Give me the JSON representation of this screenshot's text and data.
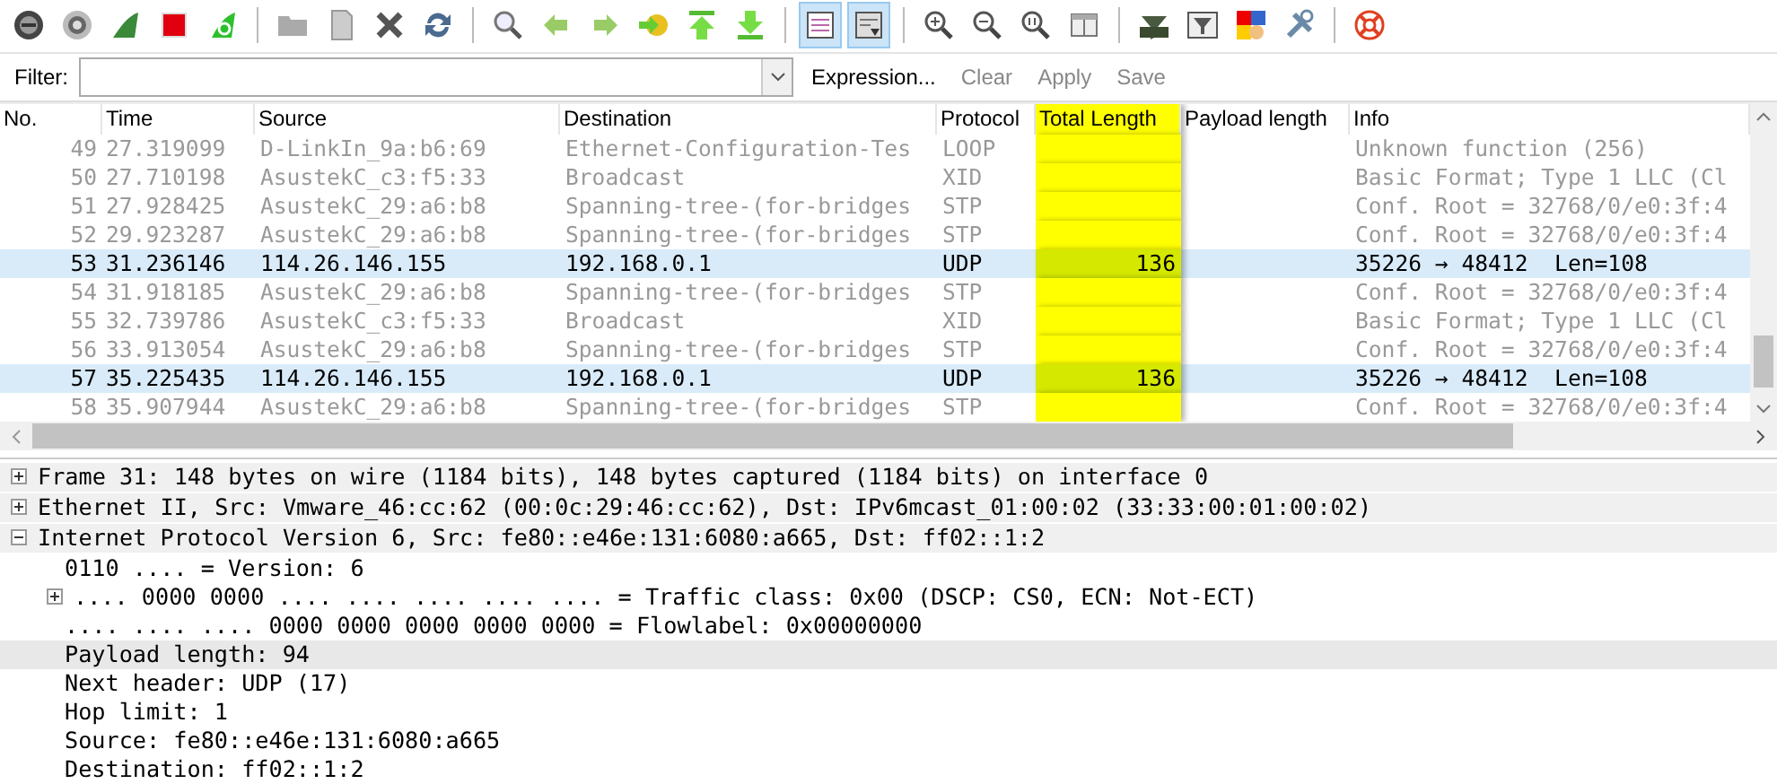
{
  "toolbar": {
    "groups": [
      [
        {
          "pressed": false
        },
        {
          "pressed": false
        },
        {
          "pressed": false
        },
        {
          "pressed": false
        },
        {
          "pressed": false
        }
      ],
      [
        {
          "pressed": false
        },
        {
          "pressed": false
        },
        {
          "pressed": false
        },
        {
          "pressed": false
        }
      ],
      [
        {
          "pressed": false
        },
        {
          "pressed": false
        },
        {
          "pressed": false
        },
        {
          "pressed": false
        },
        {
          "pressed": false
        },
        {
          "pressed": false
        }
      ],
      [
        {
          "pressed": true
        },
        {
          "pressed": true
        }
      ],
      [
        {
          "pressed": false
        },
        {
          "pressed": false
        },
        {
          "pressed": false
        },
        {
          "pressed": false
        }
      ],
      [
        {
          "pressed": false
        },
        {
          "pressed": false
        },
        {
          "pressed": false
        },
        {
          "pressed": false
        }
      ],
      [
        {
          "pressed": false
        }
      ]
    ]
  },
  "filter_bar": {
    "label": "Filter:",
    "expression": "Expression...",
    "actions": [
      {
        "label": "Clear",
        "disabled": true
      },
      {
        "label": "Apply",
        "disabled": true
      },
      {
        "label": "Save",
        "disabled": true
      }
    ]
  },
  "packet_list": {
    "columns": [
      {
        "label": "No.",
        "selected": false
      },
      {
        "label": "Time",
        "selected": false
      },
      {
        "label": "Source",
        "selected": false
      },
      {
        "label": "Destination",
        "selected": false
      },
      {
        "label": "Protocol",
        "selected": false
      },
      {
        "label": "Total Length",
        "selected": true
      },
      {
        "label": "Payload length",
        "selected": false
      },
      {
        "label": "Info",
        "selected": false
      }
    ],
    "rows": [
      {
        "no": "49",
        "time": "27.319099",
        "source": "D-LinkIn_9a:b6:69",
        "destination": "Ethernet-Configuration-Tes",
        "protocol": "LOOP",
        "info": "Unknown function (256)",
        "selected": false
      },
      {
        "no": "50",
        "time": "27.710198",
        "source": "AsustekC_c3:f5:33",
        "destination": "Broadcast",
        "protocol": "XID",
        "info": "Basic Format; Type 1 LLC (Cl",
        "selected": false
      },
      {
        "no": "51",
        "time": "27.928425",
        "source": "AsustekC_29:a6:b8",
        "destination": "Spanning-tree-(for-bridges",
        "protocol": "STP",
        "info": "Conf. Root = 32768/0/e0:3f:4",
        "selected": false
      },
      {
        "no": "52",
        "time": "29.923287",
        "source": "AsustekC_29:a6:b8",
        "destination": "Spanning-tree-(for-bridges",
        "protocol": "STP",
        "info": "Conf. Root = 32768/0/e0:3f:4",
        "selected": false
      },
      {
        "no": "53",
        "time": "31.236146",
        "source": "114.26.146.155",
        "destination": "192.168.0.1",
        "protocol": "UDP",
        "total_length": "136",
        "info": "35226 → 48412  Len=108",
        "selected": true
      },
      {
        "no": "54",
        "time": "31.918185",
        "source": "AsustekC_29:a6:b8",
        "destination": "Spanning-tree-(for-bridges",
        "protocol": "STP",
        "info": "Conf. Root = 32768/0/e0:3f:4",
        "selected": false
      },
      {
        "no": "55",
        "time": "32.739786",
        "source": "AsustekC_c3:f5:33",
        "destination": "Broadcast",
        "protocol": "XID",
        "info": "Basic Format; Type 1 LLC (Cl",
        "selected": false
      },
      {
        "no": "56",
        "time": "33.913054",
        "source": "AsustekC_29:a6:b8",
        "destination": "Spanning-tree-(for-bridges",
        "protocol": "STP",
        "info": "Conf. Root = 32768/0/e0:3f:4",
        "selected": false
      },
      {
        "no": "57",
        "time": "35.225435",
        "source": "114.26.146.155",
        "destination": "192.168.0.1",
        "protocol": "UDP",
        "total_length": "136",
        "info": "35226 → 48412  Len=108",
        "selected": true
      },
      {
        "no": "58",
        "time": "35.907944",
        "source": "AsustekC_29:a6:b8",
        "destination": "Spanning-tree-(for-bridges",
        "protocol": "STP",
        "info": "Conf. Root = 32768/0/e0:3f:4",
        "selected": false
      }
    ]
  },
  "packet_details": [
    {
      "text": "Frame 31: 148 bytes on wire (1184 bits), 148 bytes captured (1184 bits) on interface 0",
      "expanded": false,
      "selected": false
    },
    {
      "text": "Ethernet II, Src: Vmware_46:cc:62 (00:0c:29:46:cc:62), Dst: IPv6mcast_01:00:02 (33:33:00:01:00:02)",
      "expanded": false,
      "selected": false
    },
    {
      "text": "Internet Protocol Version 6, Src: fe80::e46e:131:6080:a665, Dst: ff02::1:2",
      "expanded": true,
      "selected": false,
      "children": [
        {
          "text": "0110 .... = Version: 6",
          "selected": false
        },
        {
          "text": ".... 0000 0000 .... .... .... .... .... = Traffic class: 0x00 (DSCP: CS0, ECN: Not-ECT)",
          "expanded": false,
          "selected": false
        },
        {
          "text": ".... .... .... 0000 0000 0000 0000 0000 = Flowlabel: 0x00000000",
          "selected": false
        },
        {
          "text": "Payload length: 94",
          "selected": true
        },
        {
          "text": "Next header: UDP (17)",
          "selected": false
        },
        {
          "text": "Hop limit: 1",
          "selected": false
        },
        {
          "text": "Source: fe80::e46e:131:6080:a665",
          "selected": false
        },
        {
          "text": "Destination: ff02::1:2",
          "selected": false
        }
      ]
    }
  ]
}
